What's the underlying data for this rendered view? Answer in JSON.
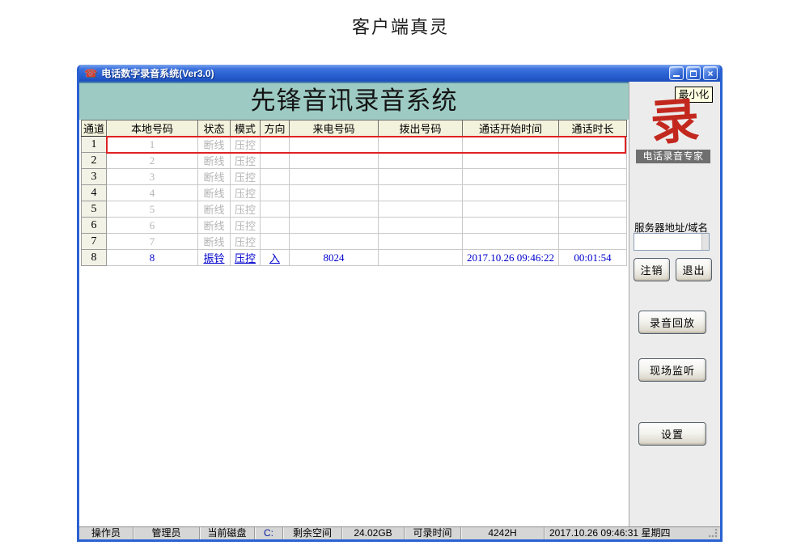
{
  "page": {
    "title": "客户端真灵"
  },
  "window": {
    "title": "电话数字录音系统(Ver3.0)"
  },
  "banner": {
    "title": "先锋音讯录音系统"
  },
  "table": {
    "headers": [
      "通道",
      "本地号码",
      "状态",
      "模式",
      "方向",
      "来电号码",
      "拨出号码",
      "通话开始时间",
      "通话时长"
    ],
    "rows": [
      {
        "channel": "1",
        "local": "1",
        "status": "断线",
        "mode": "压控",
        "direction": "",
        "caller": "",
        "dialed": "",
        "start": "",
        "duration": "",
        "state": "offline",
        "selected": true
      },
      {
        "channel": "2",
        "local": "2",
        "status": "断线",
        "mode": "压控",
        "direction": "",
        "caller": "",
        "dialed": "",
        "start": "",
        "duration": "",
        "state": "offline"
      },
      {
        "channel": "3",
        "local": "3",
        "status": "断线",
        "mode": "压控",
        "direction": "",
        "caller": "",
        "dialed": "",
        "start": "",
        "duration": "",
        "state": "offline"
      },
      {
        "channel": "4",
        "local": "4",
        "status": "断线",
        "mode": "压控",
        "direction": "",
        "caller": "",
        "dialed": "",
        "start": "",
        "duration": "",
        "state": "offline"
      },
      {
        "channel": "5",
        "local": "5",
        "status": "断线",
        "mode": "压控",
        "direction": "",
        "caller": "",
        "dialed": "",
        "start": "",
        "duration": "",
        "state": "offline"
      },
      {
        "channel": "6",
        "local": "6",
        "status": "断线",
        "mode": "压控",
        "direction": "",
        "caller": "",
        "dialed": "",
        "start": "",
        "duration": "",
        "state": "offline"
      },
      {
        "channel": "7",
        "local": "7",
        "status": "断线",
        "mode": "压控",
        "direction": "",
        "caller": "",
        "dialed": "",
        "start": "",
        "duration": "",
        "state": "offline"
      },
      {
        "channel": "8",
        "local": "8",
        "status": "振铃",
        "mode": "压控",
        "direction": "入",
        "caller": "8024",
        "dialed": "",
        "start": "2017.10.26 09:46:22",
        "duration": "00:01:54",
        "state": "active"
      }
    ]
  },
  "sidebar": {
    "minimize_label": "最小化",
    "logo_char": "录",
    "logo_caption": "电话录音专家",
    "server_label": "服务器地址/域名",
    "server_value": "",
    "buttons": {
      "logout": "注销",
      "exit": "退出",
      "playback": "录音回放",
      "monitor": "现场监听",
      "settings": "设置"
    }
  },
  "statusbar": {
    "items": [
      "操作员",
      "管理员",
      "当前磁盘",
      "C:",
      "剩余空间",
      "24.02GB",
      "可录时间",
      "4242H",
      "2017.10.26  09:46:31  星期四"
    ]
  },
  "colors": {
    "titlebar_blue": "#2a61d2",
    "window_border": "#2a61d2",
    "banner_teal": "#9dcbc3",
    "header_cream": "#f3f2dc",
    "active_row_blue": "#0000cc",
    "offline_gray": "#b4b4b4",
    "selection_red": "#e02222",
    "logo_red": "#c3281e",
    "tooltip_yellow": "#ffffe1"
  }
}
